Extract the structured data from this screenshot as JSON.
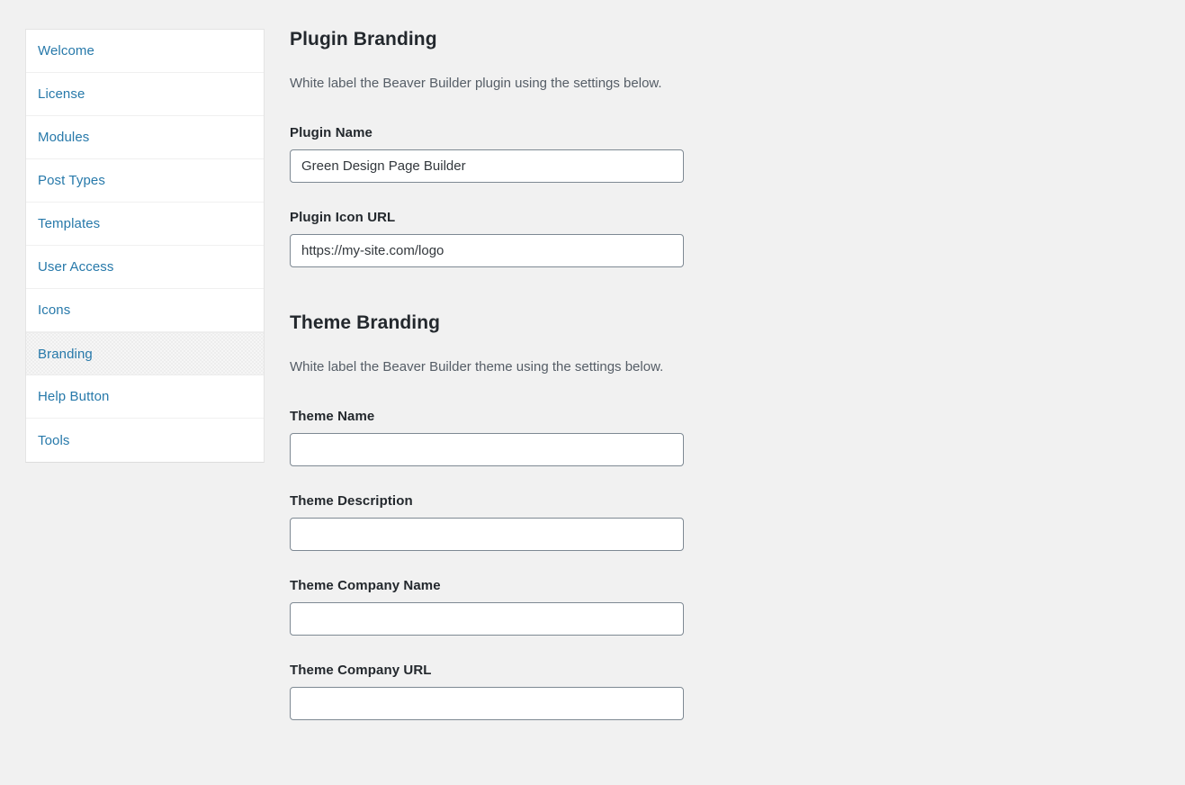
{
  "sidebar": {
    "items": [
      {
        "label": "Welcome",
        "active": false
      },
      {
        "label": "License",
        "active": false
      },
      {
        "label": "Modules",
        "active": false
      },
      {
        "label": "Post Types",
        "active": false
      },
      {
        "label": "Templates",
        "active": false
      },
      {
        "label": "User Access",
        "active": false
      },
      {
        "label": "Icons",
        "active": false
      },
      {
        "label": "Branding",
        "active": true
      },
      {
        "label": "Help Button",
        "active": false
      },
      {
        "label": "Tools",
        "active": false
      }
    ]
  },
  "plugin_branding": {
    "title": "Plugin Branding",
    "description": "White label the Beaver Builder plugin using the settings below.",
    "fields": [
      {
        "label": "Plugin Name",
        "value": "Green Design Page Builder",
        "placeholder": ""
      },
      {
        "label": "Plugin Icon URL",
        "value": "https://my-site.com/logo",
        "placeholder": ""
      }
    ]
  },
  "theme_branding": {
    "title": "Theme Branding",
    "description": "White label the Beaver Builder theme using the settings below.",
    "fields": [
      {
        "label": "Theme Name",
        "value": "",
        "placeholder": ""
      },
      {
        "label": "Theme Description",
        "value": "",
        "placeholder": ""
      },
      {
        "label": "Theme Company Name",
        "value": "",
        "placeholder": ""
      },
      {
        "label": "Theme Company URL",
        "value": "",
        "placeholder": ""
      }
    ]
  },
  "colors": {
    "page_background": "#f1f1f1",
    "panel_background": "#ffffff",
    "link": "#2779aa",
    "heading": "#23282d",
    "body_text": "#555d66",
    "input_border": "#7e8993",
    "active_item_background": "#f6f6f6"
  }
}
